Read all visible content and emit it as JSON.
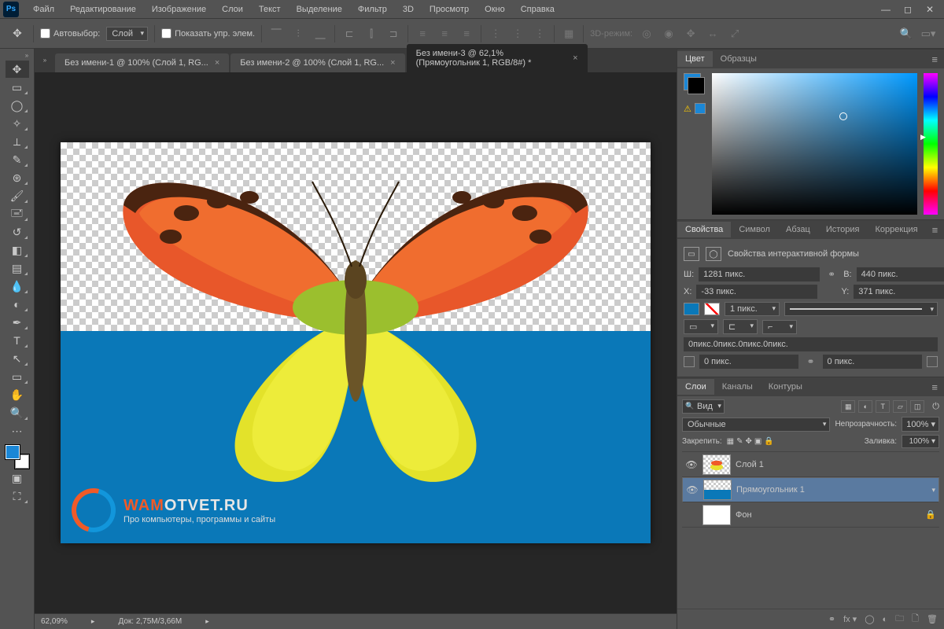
{
  "menu": {
    "items": [
      "Файл",
      "Редактирование",
      "Изображение",
      "Слои",
      "Текст",
      "Выделение",
      "Фильтр",
      "3D",
      "Просмотр",
      "Окно",
      "Справка"
    ]
  },
  "options": {
    "autoselect_label": "Автовыбор:",
    "autoselect_target": "Слой",
    "show_controls_label": "Показать упр. элем.",
    "mode3d_label": "3D-режим:"
  },
  "tabs": [
    {
      "label": "Без имени-1 @ 100% (Слой 1, RG..."
    },
    {
      "label": "Без имени-2 @ 100% (Слой 1, RG..."
    },
    {
      "label": "Без имени-3 @ 62,1% (Прямоугольник 1, RGB/8#) *"
    }
  ],
  "statusbar": {
    "zoom": "62,09%",
    "doc": "Док: 2,75M/3,66M"
  },
  "panel_color": {
    "tab1": "Цвет",
    "tab2": "Образцы"
  },
  "panel_props": {
    "tabs": [
      "Свойства",
      "Символ",
      "Абзац",
      "История",
      "Коррекция"
    ],
    "title": "Свойства интерактивной формы",
    "W_label": "Ш:",
    "W": "1281 пикс.",
    "H_label": "В:",
    "H": "440 пикс.",
    "X_label": "X:",
    "X": "-33 пикс.",
    "Y_label": "Y:",
    "Y": "371 пикс.",
    "stroke_w": "1 пикс.",
    "corners_combined": "0пикс.0пикс.0пикс.0пикс.",
    "corner_val": "0 пикс."
  },
  "panel_layers": {
    "tabs": [
      "Слои",
      "Каналы",
      "Контуры"
    ],
    "filter_kind": "Вид",
    "blend": "Обычные",
    "opacity_label": "Непрозрачность:",
    "opacity": "100%",
    "lock_label": "Закрепить:",
    "fill_label": "Заливка:",
    "fill": "100%",
    "layers": [
      {
        "name": "Слой 1"
      },
      {
        "name": "Прямоугольник 1"
      },
      {
        "name": "Фон"
      }
    ]
  },
  "watermark": {
    "line1_a": "WAM",
    "line1_b": "OTVET.RU",
    "line2": "Про компьютеры, программы и сайты"
  },
  "colors": {
    "accent_blue": "#0a78b8",
    "fg": "#1b87d6"
  }
}
